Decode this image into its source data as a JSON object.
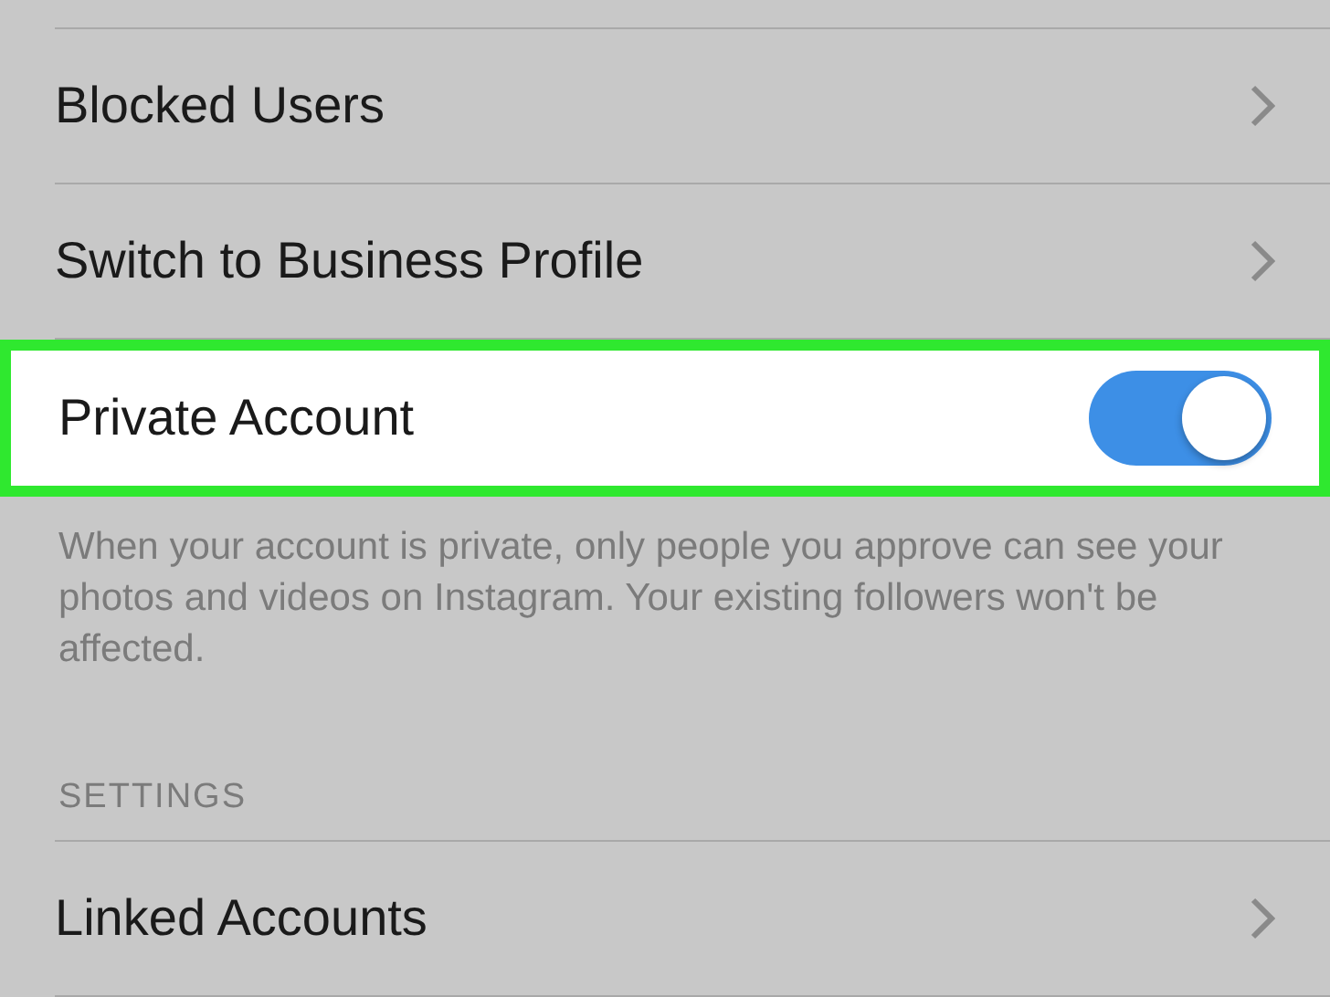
{
  "rows": [
    {
      "kind": "link",
      "label": "Blocked Users",
      "highlighted": false
    },
    {
      "kind": "link",
      "label": "Switch to Business Profile",
      "highlighted": false
    },
    {
      "kind": "toggle",
      "label": "Private Account",
      "on": true,
      "highlighted": true
    }
  ],
  "description": "When your account is private, only people you approve can see your photos and videos on Instagram. Your existing followers won't be affected.",
  "section_header": "SETTINGS",
  "section_rows": [
    {
      "kind": "link",
      "label": "Linked Accounts",
      "highlighted": false
    }
  ]
}
